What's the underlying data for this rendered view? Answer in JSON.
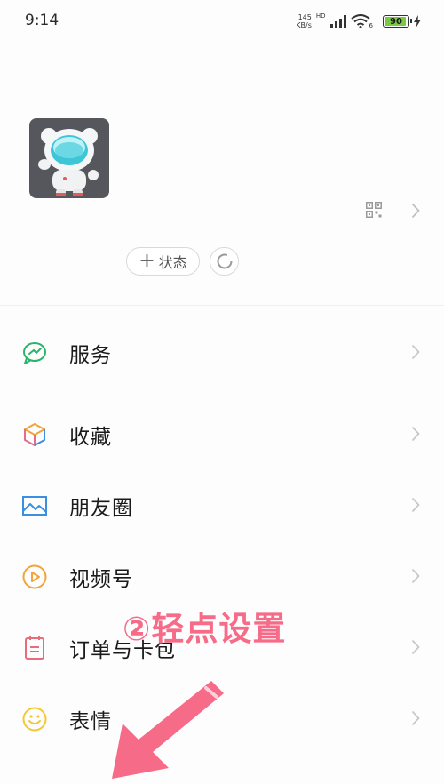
{
  "status_bar": {
    "time": "9:14",
    "net_speed_value": "145",
    "net_speed_unit": "KB/s",
    "network_badge": "HD",
    "wifi_badge": "6",
    "battery": "90",
    "battery_color": "#7ac943"
  },
  "profile": {
    "avatar_icon": "astronaut-bear-icon",
    "qr_icon": "qr-code-icon",
    "status_button": "状态",
    "status_plus": "+"
  },
  "menu": [
    {
      "label": "服务",
      "icon": "service-icon",
      "color": "#2bb36a"
    },
    {
      "label": "收藏",
      "icon": "favorites-cube-icon",
      "color": "#f2a33a"
    },
    {
      "label": "朋友圈",
      "icon": "moments-image-icon",
      "color": "#3a8fe0"
    },
    {
      "label": "视频号",
      "icon": "channels-play-icon",
      "color": "#f2a33a"
    },
    {
      "label": "订单与卡包",
      "icon": "orders-clipboard-icon",
      "color": "#ea6b7a"
    },
    {
      "label": "表情",
      "icon": "sticker-smile-icon",
      "color": "#f4c832"
    }
  ],
  "annotation": {
    "text": "②轻点设置",
    "color": "#f56b88"
  }
}
